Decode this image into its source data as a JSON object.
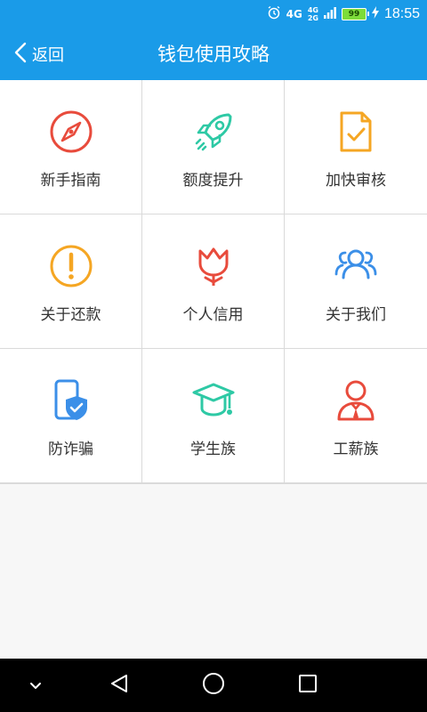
{
  "status_bar": {
    "network": "4G",
    "network_stack_top": "4G",
    "network_stack_bottom": "2G",
    "battery": "99",
    "time": "18:55"
  },
  "app_bar": {
    "back_label": "返回",
    "title": "钱包使用攻略"
  },
  "grid": {
    "items": [
      {
        "label": "新手指南",
        "icon": "compass-icon",
        "color": "#e84b3c"
      },
      {
        "label": "额度提升",
        "icon": "rocket-icon",
        "color": "#2ec9a5"
      },
      {
        "label": "加快审核",
        "icon": "document-check-icon",
        "color": "#f5a623"
      },
      {
        "label": "关于还款",
        "icon": "exclamation-circle-icon",
        "color": "#f5a623"
      },
      {
        "label": "个人信用",
        "icon": "tulip-icon",
        "color": "#e84b3c"
      },
      {
        "label": "关于我们",
        "icon": "group-icon",
        "color": "#3b8fe8"
      },
      {
        "label": "防诈骗",
        "icon": "phone-shield-icon",
        "color": "#3b8fe8"
      },
      {
        "label": "学生族",
        "icon": "graduation-cap-icon",
        "color": "#2ec9a5"
      },
      {
        "label": "工薪族",
        "icon": "worker-icon",
        "color": "#e84b3c"
      }
    ]
  },
  "colors": {
    "primary": "#1a9be8",
    "background": "#f7f7f7",
    "cell": "#ffffff",
    "text": "#333333"
  }
}
